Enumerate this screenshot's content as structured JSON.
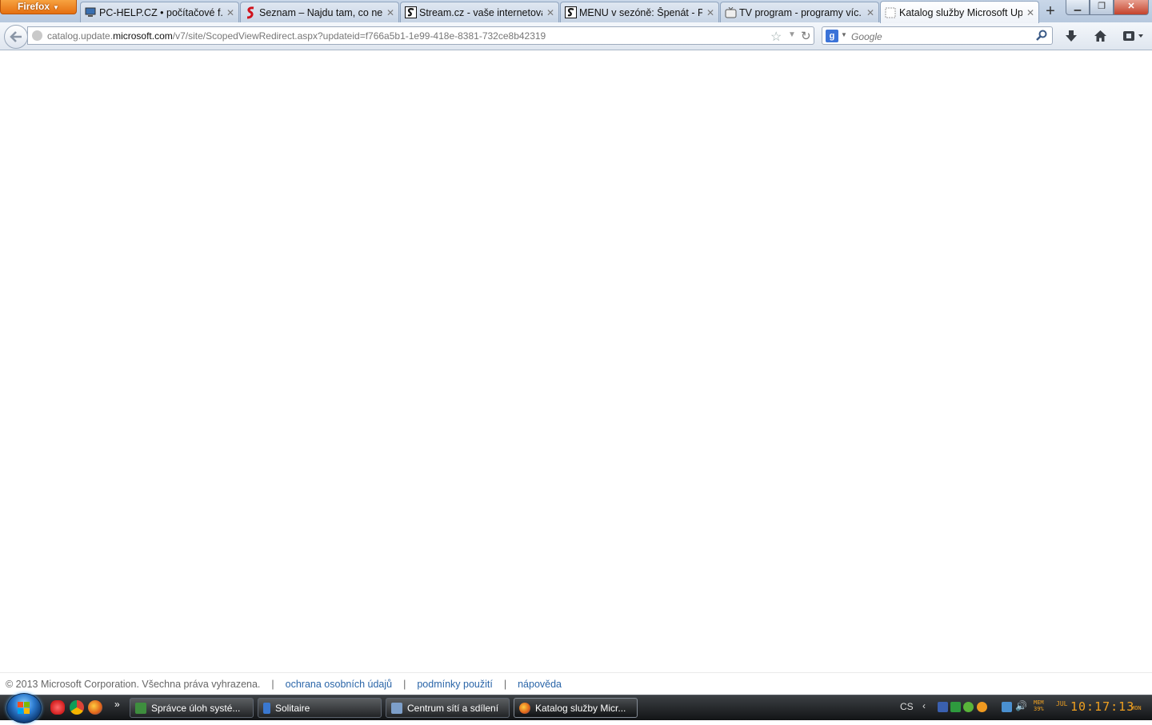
{
  "browser": {
    "app_button": "Firefox",
    "tabs": [
      {
        "label": "PC-HELP.CZ • počítačové f...",
        "icon": "computer-icon",
        "active": false
      },
      {
        "label": "Seznam – Najdu tam, co ne...",
        "icon": "seznam-icon",
        "active": false
      },
      {
        "label": "Stream.cz - vaše internetová...",
        "icon": "stream-icon",
        "active": false
      },
      {
        "label": "MENU v sezóně: Špenát - P...",
        "icon": "stream-icon",
        "active": false
      },
      {
        "label": "TV program - programy víc...",
        "icon": "tv-icon",
        "active": false
      },
      {
        "label": "Katalog služby Microsoft Up...",
        "icon": "blank-page-icon",
        "active": true
      }
    ],
    "url": {
      "prefix": "catalog.update.",
      "host": "microsoft.com",
      "path": "/v7/site/ScopedViewRedirect.aspx?updateid=f766a5b1-1e99-418e-8381-732ce8b42319"
    },
    "search": {
      "placeholder": "Google"
    }
  },
  "footer": {
    "copyright": "© 2013 Microsoft Corporation. Všechna práva vyhrazena.",
    "separator": "|",
    "links": [
      "ochrana osobních údajů",
      "podmínky použití",
      "nápověda"
    ]
  },
  "taskbar": {
    "windows": [
      {
        "label": "Správce úloh systé...",
        "active": false
      },
      {
        "label": "Solitaire",
        "active": false
      },
      {
        "label": "Centrum sítí a sdílení",
        "active": false
      },
      {
        "label": "Katalog služby Micr...",
        "active": true
      }
    ],
    "tray": {
      "language": "CS",
      "memory_label": "MEM",
      "memory_value": "39%",
      "month": "JUL",
      "time": "10:17:13",
      "day": "MON"
    }
  },
  "colors": {
    "firefox_orange": "#e56f10",
    "link_blue": "#2a65a8",
    "clock_amber": "#f0a020"
  }
}
